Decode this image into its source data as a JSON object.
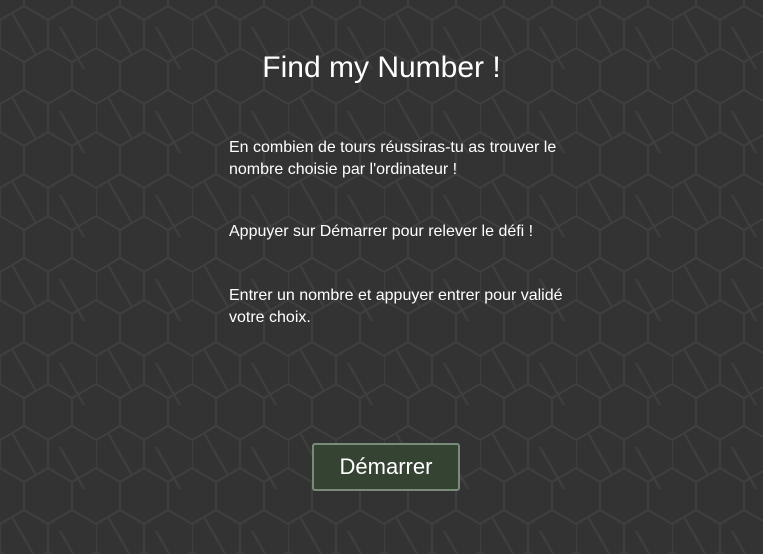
{
  "page": {
    "title": "Find my Number !"
  },
  "instructions": {
    "line1": "En combien de tours réussiras-tu as trouver le nombre choisie par l'ordinateur !",
    "line2": "Appuyer sur Démarrer pour relever le défi !",
    "line3": "Entrer un nombre et appuyer entrer pour validé votre choix."
  },
  "actions": {
    "start_label": "Démarrer"
  },
  "colors": {
    "background": "#333333",
    "pattern_stroke": "#3f3f3f",
    "button_fill": "#354333",
    "button_border": "#7a8b79",
    "text": "#ffffff"
  }
}
